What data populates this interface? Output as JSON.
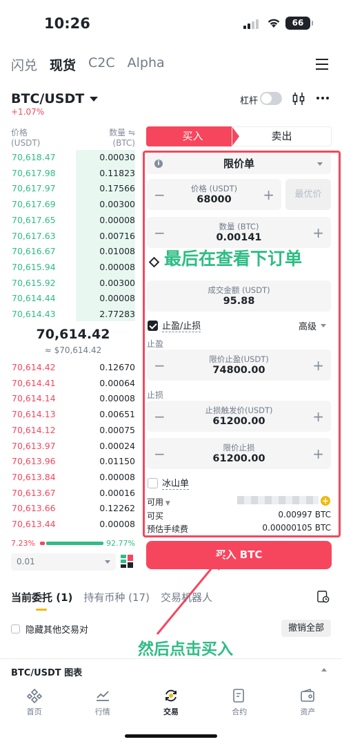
{
  "status": {
    "time": "10:26",
    "battery": "66"
  },
  "top_tabs": [
    {
      "label": "闪兑",
      "active": false
    },
    {
      "label": "现货",
      "active": true
    },
    {
      "label": "C2C",
      "active": false
    },
    {
      "label": "Alpha",
      "active": false
    }
  ],
  "pair": {
    "name": "BTC/USDT",
    "change": "+1.07%",
    "leverage_label": "杠杆"
  },
  "orderbook": {
    "price_header": "价格",
    "price_unit": "(USDT)",
    "qty_header": "数量 ⇋",
    "qty_unit": "(BTC)",
    "bids": [
      {
        "p": "70,618.47",
        "q": "0.00030"
      },
      {
        "p": "70,617.98",
        "q": "0.11823"
      },
      {
        "p": "70,617.97",
        "q": "0.17566"
      },
      {
        "p": "70,617.69",
        "q": "0.00300"
      },
      {
        "p": "70,617.65",
        "q": "0.00008"
      },
      {
        "p": "70,617.63",
        "q": "0.00716"
      },
      {
        "p": "70,616.67",
        "q": "0.01008"
      },
      {
        "p": "70,615.94",
        "q": "0.00008"
      },
      {
        "p": "70,615.92",
        "q": "0.00300"
      },
      {
        "p": "70,614.44",
        "q": "0.00008"
      },
      {
        "p": "70,614.43",
        "q": "2.77283"
      }
    ],
    "mid_price": "70,614.42",
    "mid_usd": "≈ $70,614.42",
    "asks": [
      {
        "p": "70,614.42",
        "q": "0.12670"
      },
      {
        "p": "70,614.41",
        "q": "0.00064"
      },
      {
        "p": "70,614.14",
        "q": "0.00008"
      },
      {
        "p": "70,614.13",
        "q": "0.00651"
      },
      {
        "p": "70,614.12",
        "q": "0.00075"
      },
      {
        "p": "70,613.97",
        "q": "0.00024"
      },
      {
        "p": "70,613.96",
        "q": "0.01150"
      },
      {
        "p": "70,613.84",
        "q": "0.00008"
      },
      {
        "p": "70,613.67",
        "q": "0.00016"
      },
      {
        "p": "70,613.66",
        "q": "0.12262"
      },
      {
        "p": "70,613.44",
        "q": "0.00008"
      }
    ],
    "ratio_sell": "7.23%",
    "ratio_buy": "92.77%",
    "ratio_sell_fraction": 0.0723,
    "depth": "0.01"
  },
  "form": {
    "buy_tab": "买入",
    "sell_tab": "卖出",
    "order_type": "限价单",
    "price_label": "价格 (USDT)",
    "price_value": "68000",
    "best_price": "最优价",
    "qty_label": "数量 (BTC)",
    "qty_value": "0.00141",
    "total_label": "成交金额 (USDT)",
    "total_value": "95.88",
    "tpsl_label": "止盈/止损",
    "advanced": "高级",
    "tp_section": "止盈",
    "tp_label": "限价止盈(USDT)",
    "tp_value": "74800.00",
    "sl_section": "止损",
    "sl_trigger_label": "止损触发价(USDT)",
    "sl_trigger_value": "61200.00",
    "sl_limit_label": "限价止损",
    "sl_limit_value": "61200.00",
    "iceberg": "冰山单",
    "available_label": "可用",
    "available_suffix": "T",
    "can_buy_label": "可买",
    "can_buy_value": "0.00997 BTC",
    "fee_label": "预估手续费",
    "fee_value": "0.00000105 BTC",
    "submit": "买入 BTC"
  },
  "annotations": {
    "step1": "最后在查看下订单",
    "step2": "然后点击买入"
  },
  "orders": {
    "tabs": [
      {
        "label": "当前委托 (1)",
        "active": true
      },
      {
        "label": "持有币种 (17)",
        "active": false
      },
      {
        "label": "交易机器人",
        "active": false
      }
    ],
    "hide_others": "隐藏其他交易对",
    "cancel_all": "撤销全部"
  },
  "chart_bar": "BTC/USDT 图表",
  "nav": [
    {
      "label": "首页",
      "icon": "home-icon"
    },
    {
      "label": "行情",
      "icon": "markets-icon"
    },
    {
      "label": "交易",
      "icon": "trade-icon"
    },
    {
      "label": "合约",
      "icon": "futures-icon"
    },
    {
      "label": "资产",
      "icon": "wallet-icon"
    }
  ],
  "colors": {
    "buy": "#f6465d",
    "bid": "#2ebd85",
    "annotation": "#2ebd85",
    "accent": "#f0b90b"
  }
}
